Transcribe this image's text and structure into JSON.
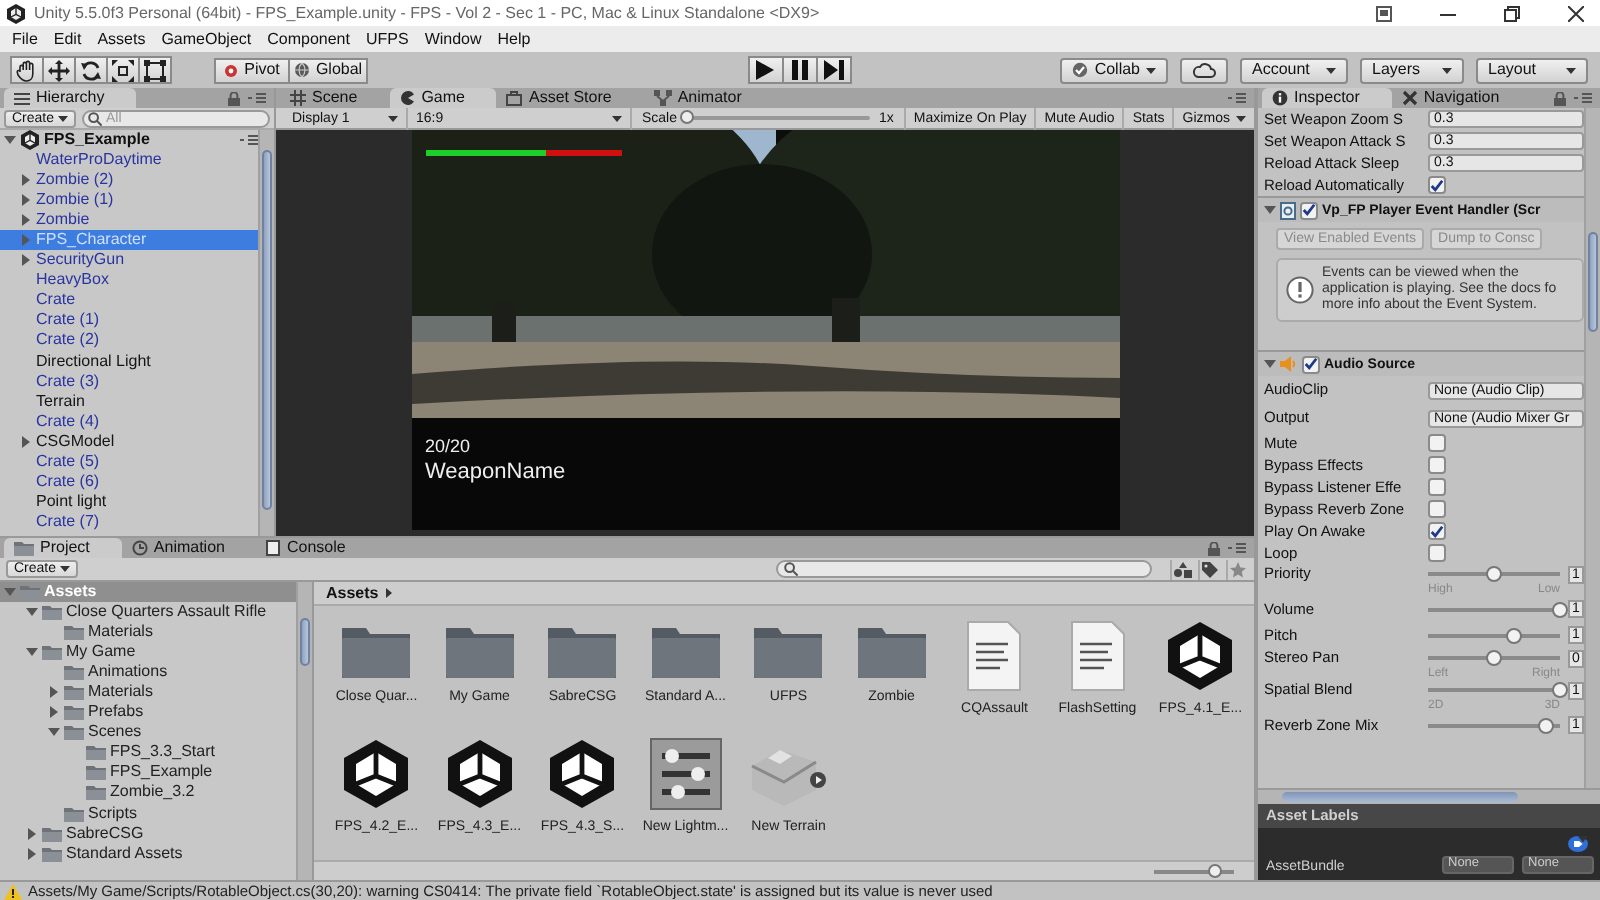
{
  "window": {
    "title": "Unity 5.5.0f3 Personal (64bit) - FPS_Example.unity - FPS - Vol 2 - Sec 1 - PC, Mac & Linux Standalone <DX9>"
  },
  "menu": [
    "File",
    "Edit",
    "Assets",
    "GameObject",
    "Component",
    "UFPS",
    "Window",
    "Help"
  ],
  "toolbar": {
    "pivot": "Pivot",
    "global": "Global",
    "collab": "Collab",
    "account": "Account",
    "layers": "Layers",
    "layout": "Layout"
  },
  "hierarchy": {
    "tabs": [
      {
        "label": "Hierarchy",
        "selected": true
      }
    ],
    "create": "Create",
    "search": {
      "placeholder": "All"
    },
    "scene": {
      "label": "FPS_Example",
      "expanded": true,
      "children": [
        {
          "label": "WaterProDaytime",
          "kind": "prefab",
          "selected": false
        },
        {
          "label": "Zombie (2)",
          "kind": "prefab",
          "selected": false,
          "expanded": false
        },
        {
          "label": "Zombie (1)",
          "kind": "prefab",
          "selected": false,
          "expanded": false
        },
        {
          "label": "Zombie",
          "kind": "prefab",
          "selected": false,
          "expanded": false
        },
        {
          "label": "FPS_Character",
          "kind": "prefab",
          "selected": true,
          "expanded": false
        },
        {
          "label": "SecurityGun",
          "kind": "prefab",
          "selected": false,
          "expanded": false
        },
        {
          "label": "HeavyBox",
          "kind": "prefab",
          "selected": false
        },
        {
          "label": "Crate",
          "kind": "prefab",
          "selected": false
        },
        {
          "label": "Crate (1)",
          "kind": "prefab",
          "selected": false
        },
        {
          "label": "Crate (2)",
          "kind": "prefab",
          "selected": false
        },
        {
          "label": "Directional Light",
          "kind": "object",
          "selected": false
        },
        {
          "label": "Crate (3)",
          "kind": "prefab",
          "selected": false
        },
        {
          "label": "Terrain",
          "kind": "object",
          "selected": false
        },
        {
          "label": "Crate (4)",
          "kind": "prefab",
          "selected": false
        },
        {
          "label": "CSGModel",
          "kind": "object",
          "selected": false,
          "expanded": false
        },
        {
          "label": "Crate (5)",
          "kind": "prefab",
          "selected": false
        },
        {
          "label": "Crate (6)",
          "kind": "prefab",
          "selected": false
        },
        {
          "label": "Point light",
          "kind": "object",
          "selected": false
        },
        {
          "label": "Crate (7)",
          "kind": "prefab",
          "selected": false
        }
      ]
    }
  },
  "game": {
    "tabs": [
      {
        "label": "Scene",
        "selected": false
      },
      {
        "label": "Game",
        "selected": true
      },
      {
        "label": "Asset Store",
        "selected": false
      },
      {
        "label": "Animator",
        "selected": false
      }
    ],
    "display": "Display 1",
    "aspect": "16:9",
    "scale": {
      "label": "Scale",
      "level": 0,
      "value": "1x"
    },
    "buttons": [
      "Maximize On Play",
      "Mute Audio",
      "Stats",
      "Gizmos"
    ],
    "hud": {
      "health": {
        "level": 0.62
      },
      "ammo": "20/20",
      "weapon": "WeaponName"
    }
  },
  "inspector": {
    "tabs": [
      {
        "label": "Inspector",
        "selected": true
      },
      {
        "label": "Navigation",
        "selected": false
      }
    ],
    "fields": [
      {
        "kind": "value",
        "label": "Set Weapon Zoom S",
        "value": "0.3"
      },
      {
        "kind": "value",
        "label": "Set Weapon Attack S",
        "value": "0.3"
      },
      {
        "kind": "value",
        "label": "Reload Attack Sleep",
        "value": "0.3"
      },
      {
        "kind": "toggle",
        "label": "Reload Automatically",
        "checked": true
      }
    ],
    "components": [
      {
        "kind": "script",
        "title": "Vp_FP Player Event Handler (Scr",
        "enabled": true,
        "expanded": true,
        "buttons": [
          {
            "label": "View Enabled Events",
            "disabled": true
          },
          {
            "label": "Dump to Consc",
            "disabled": true
          }
        ],
        "help": "Events can be viewed when the application is playing. See the docs fo more info about the Event System."
      },
      {
        "kind": "audio",
        "title": "Audio Source",
        "enabled": true,
        "expanded": true,
        "properties": [
          {
            "kind": "object",
            "label": "AudioClip",
            "value": "None (Audio Clip)"
          },
          {
            "kind": "object",
            "label": "Output",
            "value": "None (Audio Mixer Gr"
          },
          {
            "kind": "toggle",
            "label": "Mute",
            "checked": false
          },
          {
            "kind": "toggle",
            "label": "Bypass Effects",
            "checked": false
          },
          {
            "kind": "toggle",
            "label": "Bypass Listener Effe",
            "checked": false
          },
          {
            "kind": "toggle",
            "label": "Bypass Reverb Zone",
            "checked": false
          },
          {
            "kind": "toggle",
            "label": "Play On Awake",
            "checked": true
          },
          {
            "kind": "toggle",
            "label": "Loop",
            "checked": false
          },
          {
            "kind": "slider",
            "label": "Priority",
            "level": 0.5,
            "value": "1",
            "min_label": "High",
            "max_label": "Low"
          },
          {
            "kind": "slider",
            "label": "Volume",
            "level": 1,
            "value": "1"
          },
          {
            "kind": "slider",
            "label": "Pitch",
            "level": 0.65,
            "value": "1"
          },
          {
            "kind": "slider",
            "label": "Stereo Pan",
            "level": 0.5,
            "value": "0",
            "min_label": "Left",
            "max_label": "Right"
          },
          {
            "kind": "slider",
            "label": "Spatial Blend",
            "level": 1,
            "value": "1",
            "min_label": "2D",
            "max_label": "3D"
          },
          {
            "kind": "slider",
            "label": "Reverb Zone Mix",
            "level": 0.9,
            "value": "1"
          }
        ]
      }
    ],
    "asset_labels": {
      "title": "Asset Labels",
      "bundle_label": "AssetBundle",
      "bundle": "None",
      "variant": "None"
    }
  },
  "project": {
    "tabs": [
      {
        "label": "Project",
        "selected": true
      },
      {
        "label": "Animation",
        "selected": false
      },
      {
        "label": "Console",
        "selected": false
      }
    ],
    "create": "Create",
    "tree": [
      {
        "label": "Assets",
        "selected": true,
        "expanded": true,
        "children": [
          {
            "label": "Close Quarters Assault Rifle",
            "selected": false,
            "expanded": true,
            "children": [
              {
                "label": "Materials",
                "selected": false
              }
            ]
          },
          {
            "label": "My Game",
            "selected": false,
            "expanded": true,
            "children": [
              {
                "label": "Animations",
                "selected": false
              },
              {
                "label": "Materials",
                "selected": false,
                "expanded": false
              },
              {
                "label": "Prefabs",
                "selected": false,
                "expanded": false
              },
              {
                "label": "Scenes",
                "selected": false,
                "expanded": true,
                "children": [
                  {
                    "label": "FPS_3.3_Start",
                    "selected": false
                  },
                  {
                    "label": "FPS_Example",
                    "selected": false
                  },
                  {
                    "label": "Zombie_3.2",
                    "selected": false
                  }
                ]
              },
              {
                "label": "Scripts",
                "selected": false
              }
            ]
          },
          {
            "label": "SabreCSG",
            "selected": false,
            "expanded": false
          },
          {
            "label": "Standard Assets",
            "selected": false,
            "expanded": false
          }
        ]
      }
    ],
    "breadcrumb": "Assets",
    "items": [
      {
        "label": "Close Quar...",
        "kind": "folder"
      },
      {
        "label": "My Game",
        "kind": "folder"
      },
      {
        "label": "SabreCSG",
        "kind": "folder"
      },
      {
        "label": "Standard A...",
        "kind": "folder"
      },
      {
        "label": "UFPS",
        "kind": "folder"
      },
      {
        "label": "Zombie",
        "kind": "folder"
      },
      {
        "label": "CQAssault",
        "kind": "document"
      },
      {
        "label": "FlashSetting",
        "kind": "document"
      },
      {
        "label": "FPS_4.1_E...",
        "kind": "scene"
      },
      {
        "label": "FPS_4.2_E...",
        "kind": "scene"
      },
      {
        "label": "FPS_4.3_E...",
        "kind": "scene"
      },
      {
        "label": "FPS_4.3_S...",
        "kind": "scene"
      },
      {
        "label": "New Lightm...",
        "kind": "lightmap"
      },
      {
        "label": "New Terrain",
        "kind": "terrain"
      }
    ],
    "zoom": {
      "level": 0.75
    }
  },
  "status_bar": {
    "message": "Assets/My Game/Scripts/RotableObject.cs(30,20): warning CS0414: The private field `RotableObject.state' is assigned but its value is never used"
  }
}
